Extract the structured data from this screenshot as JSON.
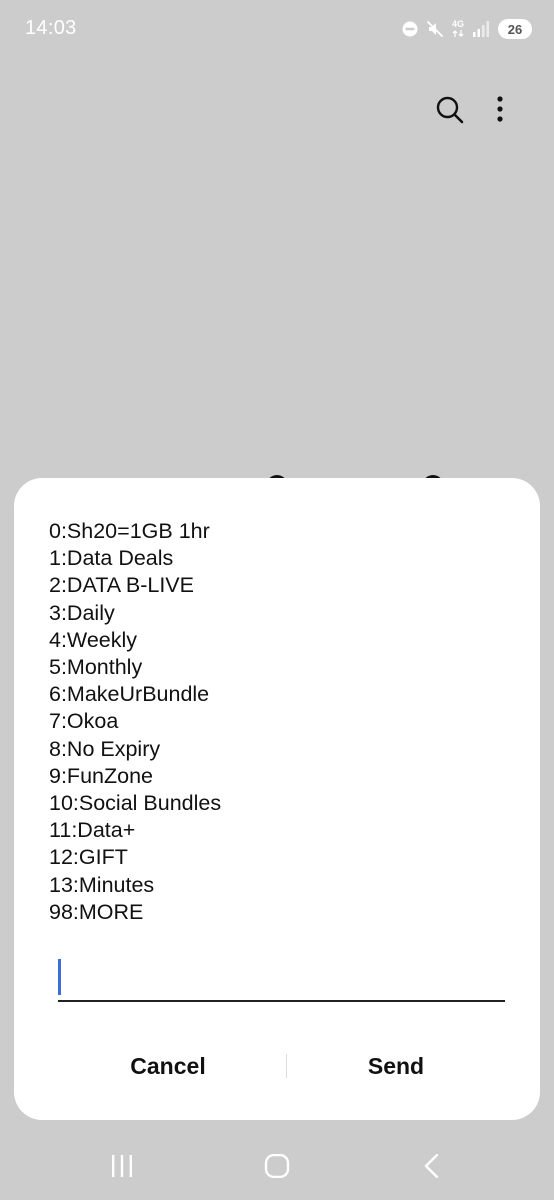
{
  "status_bar": {
    "time": "14:03",
    "network": "4G",
    "battery": "26",
    "icons": [
      "do-not-disturb-icon",
      "mute-icon",
      "network-4g-icon",
      "signal-icon",
      "battery-icon"
    ]
  },
  "app_bar": {
    "icons": [
      "search-icon",
      "more-options-icon"
    ]
  },
  "dialog": {
    "menu_items": [
      "0:Sh20=1GB 1hr",
      "1:Data Deals",
      "2:DATA B-LIVE",
      "3:Daily",
      "4:Weekly",
      "5:Monthly",
      "6:MakeUrBundle",
      "7:Okoa",
      "8:No Expiry",
      "9:FunZone",
      "10:Social Bundles",
      "11:Data+",
      "12:GIFT",
      "13:Minutes",
      "98:MORE"
    ],
    "input": {
      "value": "",
      "placeholder": ""
    },
    "cancel_label": "Cancel",
    "send_label": "Send"
  },
  "nav_bar": {
    "icons": [
      "recents-icon",
      "home-icon",
      "back-icon"
    ]
  },
  "colors": {
    "background": "#cccccc",
    "dialog": "#ffffff",
    "caret": "#3b6fd6"
  }
}
